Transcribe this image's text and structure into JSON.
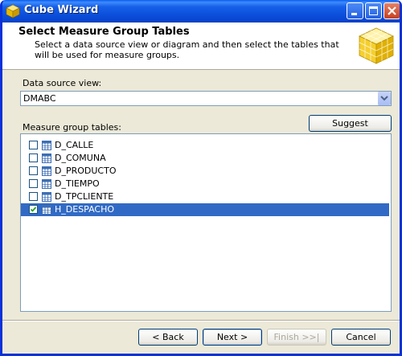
{
  "window": {
    "title": "Cube Wizard"
  },
  "header": {
    "title": "Select Measure Group Tables",
    "description": "Select a data source view or diagram and then select the tables that will be used for measure groups."
  },
  "data_source": {
    "label": "Data source view:",
    "value": "DMABC"
  },
  "measure_group": {
    "label": "Measure group tables:",
    "suggest_label": "Suggest",
    "tables": [
      {
        "name": "D_CALLE",
        "checked": false,
        "selected": false
      },
      {
        "name": "D_COMUNA",
        "checked": false,
        "selected": false
      },
      {
        "name": "D_PRODUCTO",
        "checked": false,
        "selected": false
      },
      {
        "name": "D_TIEMPO",
        "checked": false,
        "selected": false
      },
      {
        "name": "D_TPCLIENTE",
        "checked": false,
        "selected": false
      },
      {
        "name": "H_DESPACHO",
        "checked": true,
        "selected": true
      }
    ]
  },
  "footer": {
    "back": "< Back",
    "next": "Next >",
    "finish": "Finish >>|",
    "cancel": "Cancel"
  }
}
